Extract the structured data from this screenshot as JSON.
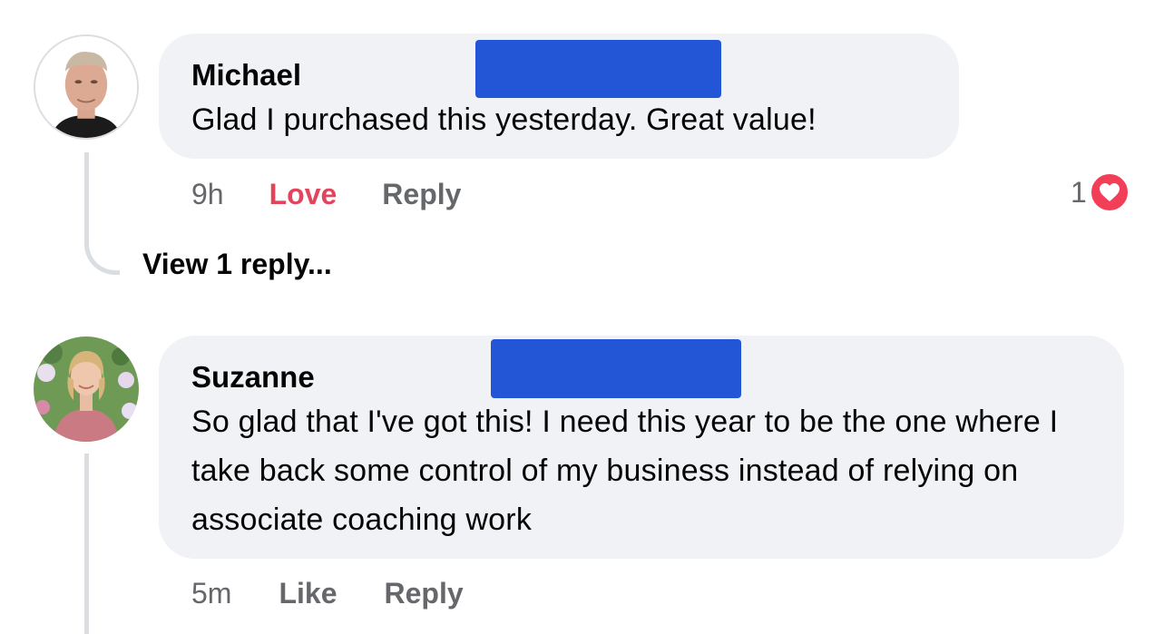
{
  "comments": [
    {
      "author": "Michael",
      "text": "Glad I purchased this yesterday. Great value!",
      "time": "9h",
      "reaction_action": "Love",
      "reply_label": "Reply",
      "reaction_count": "1",
      "reaction_icon": "heart-icon",
      "view_replies": "View 1 reply..."
    },
    {
      "author": "Suzanne",
      "text": "So glad that I've got this! I need this year to be the one where I take back some control of my business instead of relying on associate coaching work",
      "time": "5m",
      "reaction_action": "Like",
      "reply_label": "Reply"
    }
  ],
  "colors": {
    "bubble": "#f0f2f5",
    "redaction": "#2356d6",
    "love": "#e2445c",
    "heart_badge": "#f33e58",
    "meta_text": "#65676b"
  }
}
